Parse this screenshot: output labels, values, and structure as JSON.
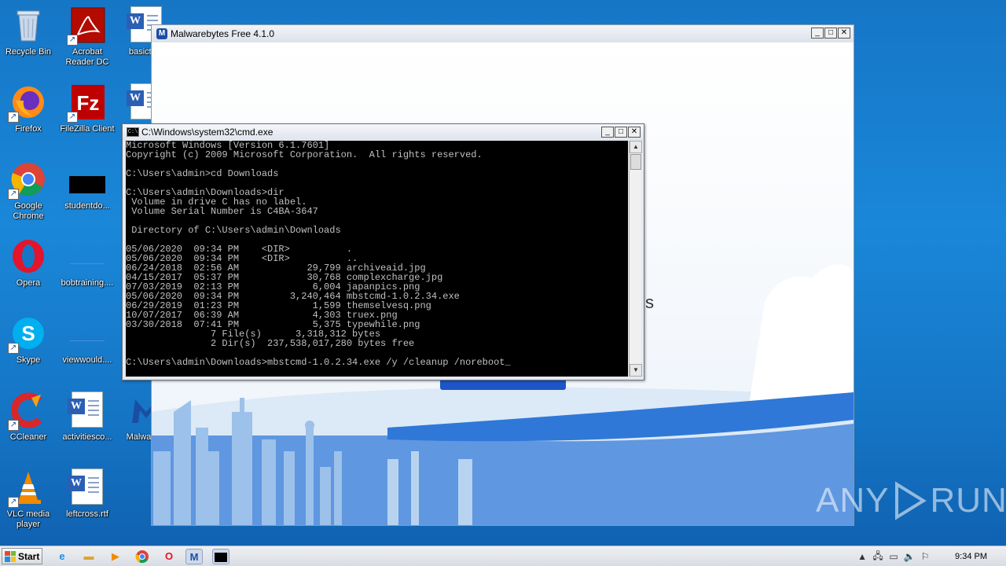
{
  "desktop": {
    "icons": [
      {
        "label": "Recycle Bin"
      },
      {
        "label": "Acrobat Reader DC"
      },
      {
        "label": "basicta..."
      },
      {
        "label": "Firefox"
      },
      {
        "label": "FileZilla Client"
      },
      {
        "label": "Google Chrome"
      },
      {
        "label": "studentdo..."
      },
      {
        "label": "Opera"
      },
      {
        "label": "bobtraining...."
      },
      {
        "label": "Skype"
      },
      {
        "label": "viewwould...."
      },
      {
        "label": "CCleaner"
      },
      {
        "label": "activitiesco..."
      },
      {
        "label": "Malware..."
      },
      {
        "label": "VLC media player"
      },
      {
        "label": "leftcross.rtf"
      }
    ]
  },
  "malwarebytes_window": {
    "title": "Malwarebytes Free  4.1.0",
    "partial_text": "s",
    "controls": {
      "minimize": "_",
      "maximize": "□",
      "close": "✕"
    }
  },
  "cmd_window": {
    "title": "C:\\Windows\\system32\\cmd.exe",
    "controls": {
      "minimize": "_",
      "maximize": "□",
      "close": "✕"
    },
    "lines": [
      "Microsoft Windows [Version 6.1.7601]",
      "Copyright (c) 2009 Microsoft Corporation.  All rights reserved.",
      "",
      "C:\\Users\\admin>cd Downloads",
      "",
      "C:\\Users\\admin\\Downloads>dir",
      " Volume in drive C has no label.",
      " Volume Serial Number is C4BA-3647",
      "",
      " Directory of C:\\Users\\admin\\Downloads",
      "",
      "05/06/2020  09:34 PM    <DIR>          .",
      "05/06/2020  09:34 PM    <DIR>          ..",
      "06/24/2018  02:56 AM            29,799 archiveaid.jpg",
      "04/15/2017  05:37 PM            30,768 complexcharge.jpg",
      "07/03/2019  02:13 PM             6,004 japanpics.png",
      "05/06/2020  09:34 PM         3,240,464 mbstcmd-1.0.2.34.exe",
      "06/29/2019  01:23 PM             1,599 themselvesq.png",
      "10/07/2017  06:39 AM             4,303 truex.png",
      "03/30/2018  07:41 PM             5,375 typewhile.png",
      "               7 File(s)      3,318,312 bytes",
      "               2 Dir(s)  237,538,017,280 bytes free",
      "",
      "C:\\Users\\admin\\Downloads>mbstcmd-1.0.2.34.exe /y /cleanup /noreboot_"
    ]
  },
  "taskbar": {
    "start_label": "Start",
    "clock": "9:34 PM"
  },
  "watermark": {
    "left": "ANY",
    "right": "RUN"
  }
}
